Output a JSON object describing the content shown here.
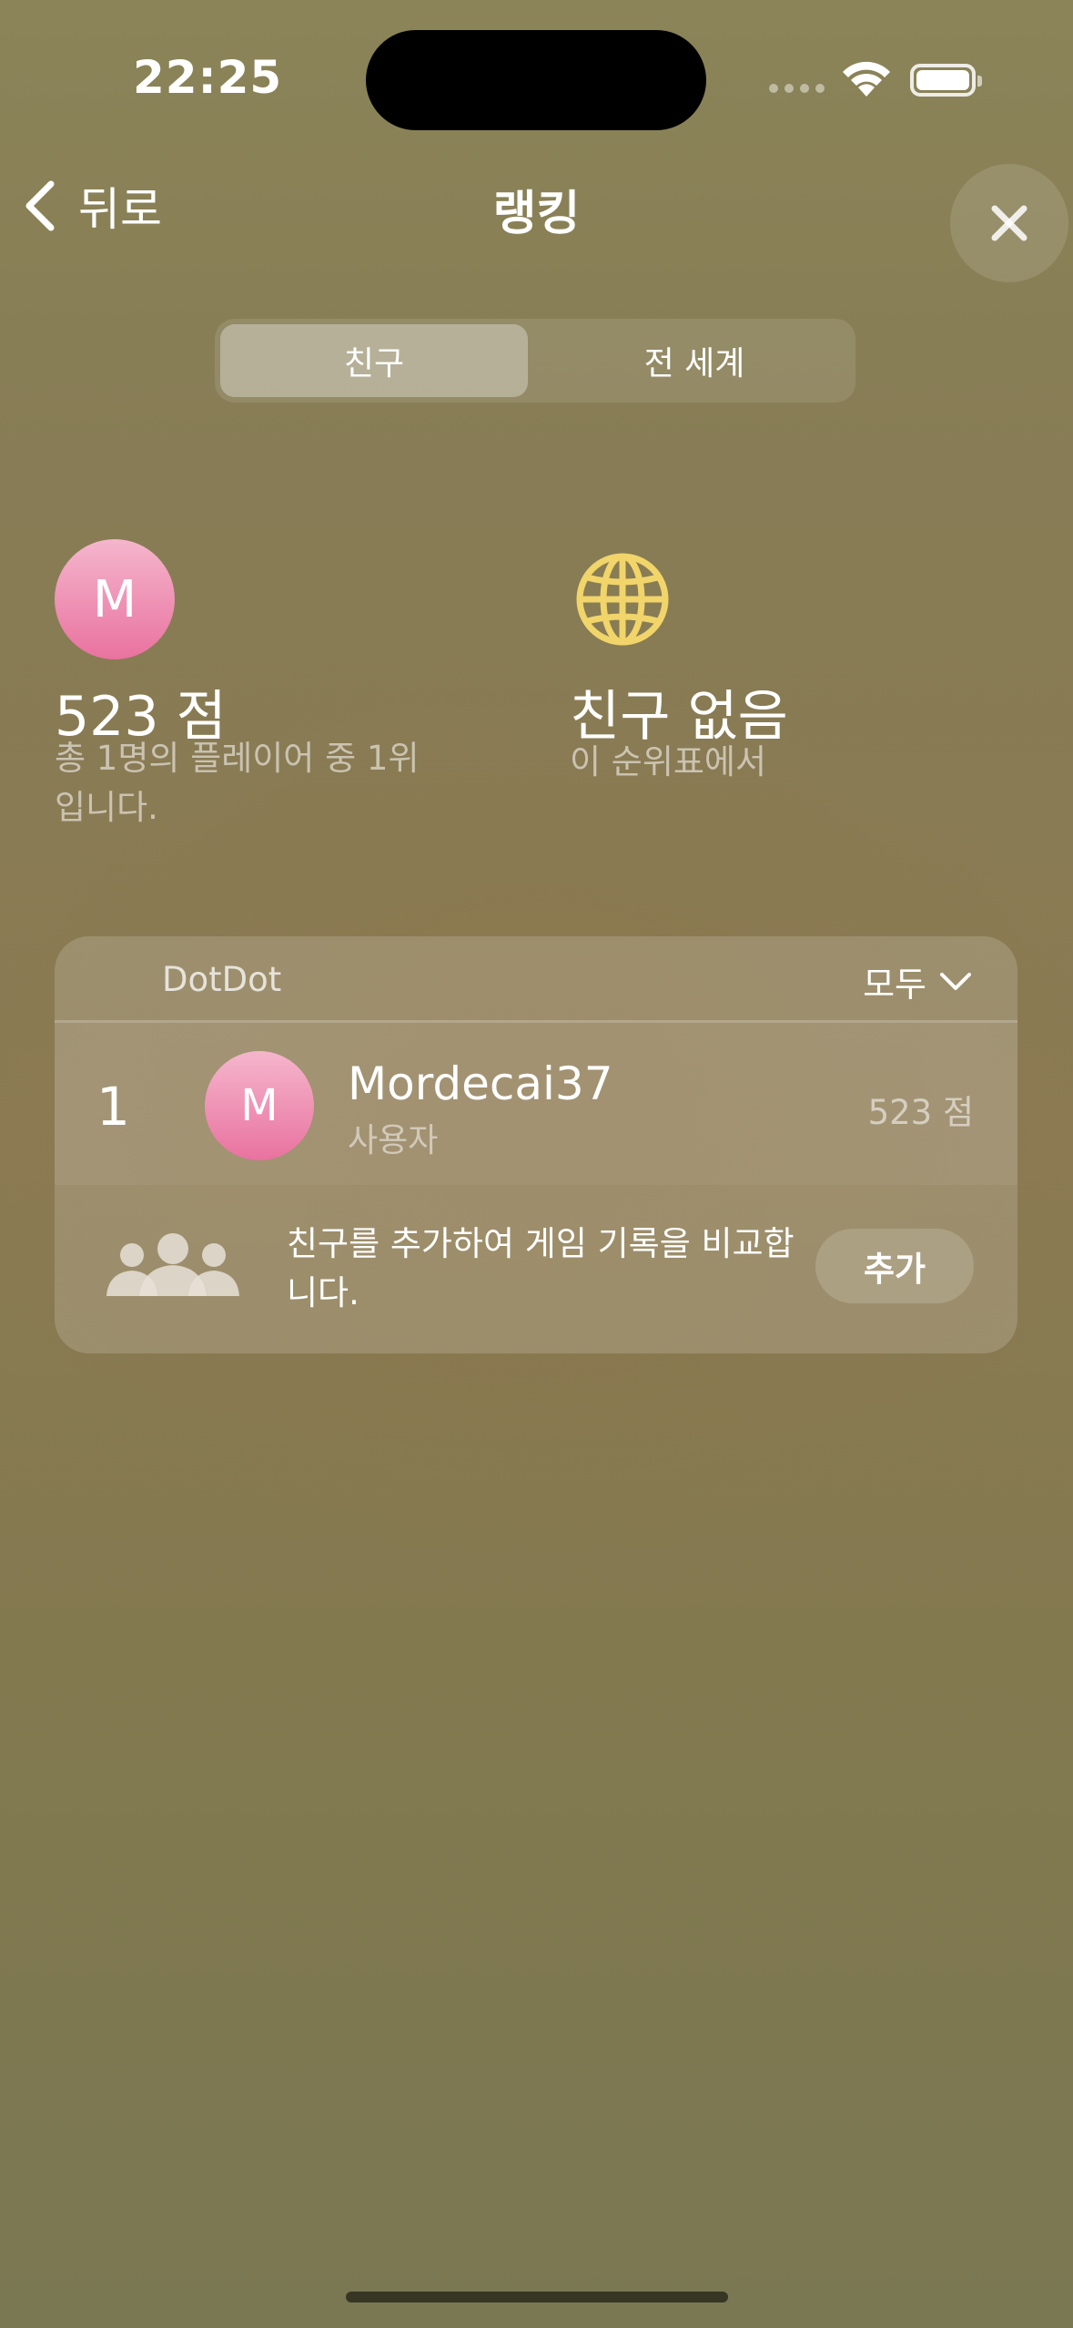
{
  "status_bar": {
    "time": "22:25"
  },
  "nav": {
    "back_label": "뒤로",
    "title": "랭킹"
  },
  "segments": {
    "selected": "친구",
    "other": "전 세계"
  },
  "summary": {
    "avatar_initial": "M",
    "score": "523 점",
    "rank_text": "총 1명의 플레이어 중 1위입니다.",
    "friends_title": "친구 없음",
    "friends_sub": "이 순위표에서"
  },
  "leaderboard": {
    "game_name": "DotDot",
    "filter_label": "모두",
    "rows": [
      {
        "rank": "1",
        "initial": "M",
        "name": "Mordecai37",
        "role": "사용자",
        "score": "523 점"
      }
    ]
  },
  "invite": {
    "text": "친구를 추가하여 게임 기록을 비교합니다.",
    "button_label": "추가"
  },
  "colors": {
    "avatar_pink": "#e9729f",
    "globe_yellow": "#f1d56a"
  },
  "icons": [
    "chevron-left-icon",
    "close-icon",
    "globe-icon",
    "chevron-down-icon",
    "people-icon",
    "wifi-icon",
    "battery-icon"
  ]
}
